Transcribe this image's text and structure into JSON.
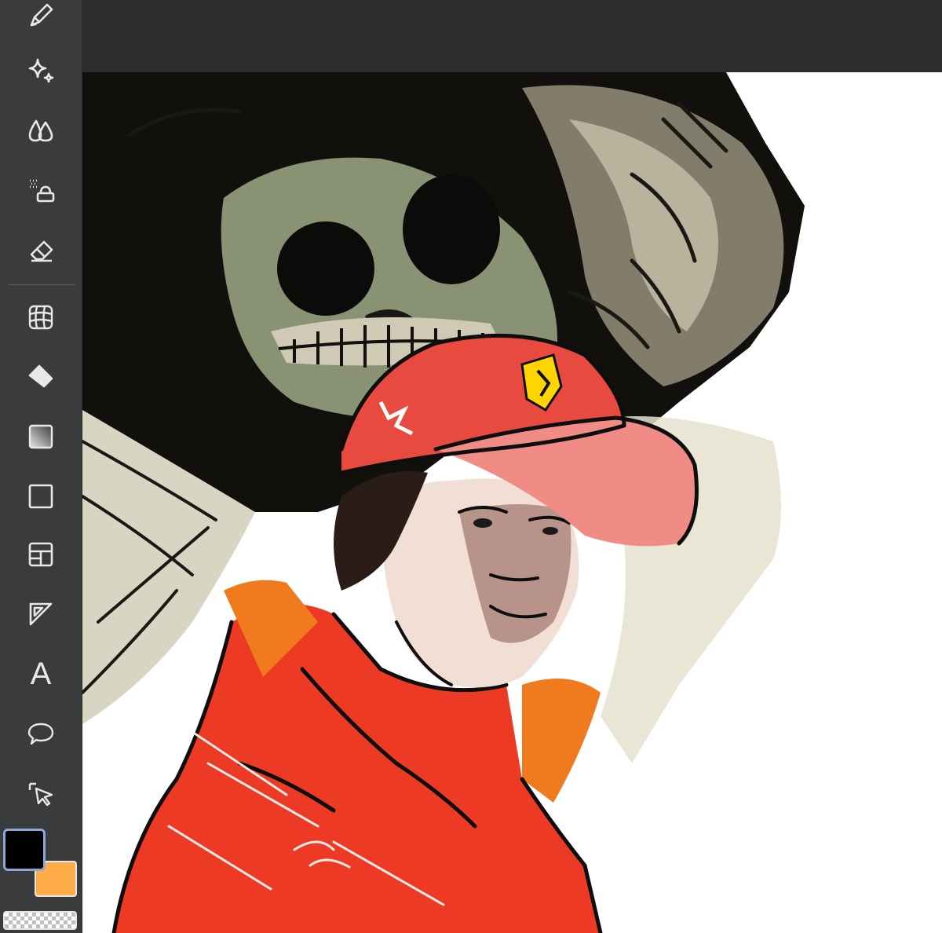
{
  "toolbar": {
    "tools": [
      {
        "name": "pen-tool",
        "icon": "pen-icon"
      },
      {
        "name": "magic-tool",
        "icon": "sparkle-icon"
      },
      {
        "name": "blur-tool",
        "icon": "drops-icon"
      },
      {
        "name": "spray-fill-tool",
        "icon": "spray-icon"
      },
      {
        "name": "eraser-tool",
        "icon": "eraser-icon"
      },
      {
        "name": "transform-tool",
        "icon": "grid-transform-icon"
      },
      {
        "name": "fill-tool",
        "icon": "bucket-icon"
      },
      {
        "name": "gradient-tool",
        "icon": "gradient-icon"
      },
      {
        "name": "shape-tool",
        "icon": "rectangle-icon"
      },
      {
        "name": "panel-tool",
        "icon": "panel-layout-icon"
      },
      {
        "name": "ruler-tool",
        "icon": "triangle-ruler-icon"
      },
      {
        "name": "text-tool",
        "icon": "text-icon",
        "label": "A"
      },
      {
        "name": "speech-bubble-tool",
        "icon": "speech-bubble-icon"
      },
      {
        "name": "select-tool",
        "icon": "cursor-select-icon"
      }
    ]
  },
  "colors": {
    "primary": "#000000",
    "secondary": "#ffad4a",
    "toolbar_bg": "#3a3b3d",
    "topbar_bg": "#2d2d2f",
    "active_swatch_border": "#8aa7d8"
  }
}
